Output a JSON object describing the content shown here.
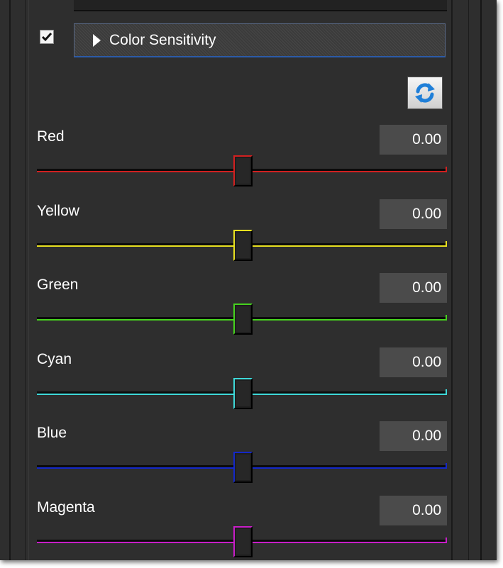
{
  "section": {
    "title": "Color Sensitivity",
    "checked": true
  },
  "reset_icon": "refresh-icon",
  "sliders": [
    {
      "label": "Red",
      "value": "0.00",
      "color": "#d22020",
      "position": 0.5
    },
    {
      "label": "Yellow",
      "value": "0.00",
      "color": "#e8e020",
      "position": 0.5
    },
    {
      "label": "Green",
      "value": "0.00",
      "color": "#46d21e",
      "position": 0.5
    },
    {
      "label": "Cyan",
      "value": "0.00",
      "color": "#3ed8d8",
      "position": 0.5
    },
    {
      "label": "Blue",
      "value": "0.00",
      "color": "#1428c8",
      "position": 0.5
    },
    {
      "label": "Magenta",
      "value": "0.00",
      "color": "#c81ec8",
      "position": 0.5
    }
  ]
}
